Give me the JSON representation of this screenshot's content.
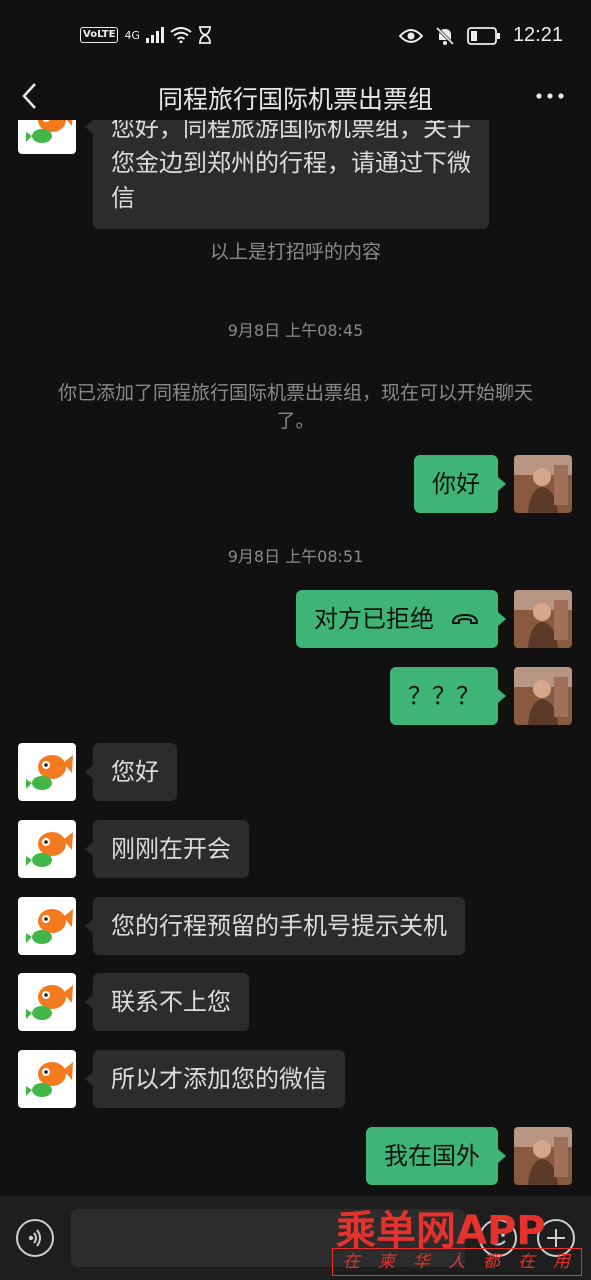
{
  "status_bar": {
    "volte": "VoLTE",
    "network": "4G",
    "time": "12:21"
  },
  "header": {
    "title": "同程旅行国际机票出票组"
  },
  "messages": {
    "partial_greeting": "您好，同程旅游国际机票组，关于您金边到郑州的行程，请通过下微信",
    "greeting_line1": "您好，同程旅游国际机票组，关于",
    "greeting_line2": "您金边到郑州的行程，请通过下微",
    "greeting_line3": "信",
    "sys_greeting_above": "以上是打招呼的内容",
    "ts1": "9月8日 上午08:45",
    "sys_added": "你已添加了同程旅行国际机票出票组，现在可以开始聊天了。",
    "me_hello": "你好",
    "ts2": "9月8日 上午08:51",
    "me_call_rejected": "对方已拒绝",
    "me_question": "？？？",
    "them_hello": "您好",
    "them_meeting": "刚刚在开会",
    "them_phone_off": "您的行程预留的手机号提示关机",
    "them_cannot_reach": "联系不上您",
    "them_added_wechat": "所以才添加您的微信",
    "me_abroad": "我在国外"
  },
  "watermark": {
    "brand": "乘单网APP",
    "slogan": "在柬华人都在用"
  },
  "icons": {
    "back": "back-chevron-icon",
    "more": "more-dots-icon",
    "voice": "voice-icon",
    "emoji": "emoji-icon",
    "plus": "plus-icon",
    "call_end": "call-end-icon"
  },
  "colors": {
    "background": "#111111",
    "bubble_me": "#3eb476",
    "bubble_them": "#2c2c2c",
    "watermark": "#e5322d"
  }
}
